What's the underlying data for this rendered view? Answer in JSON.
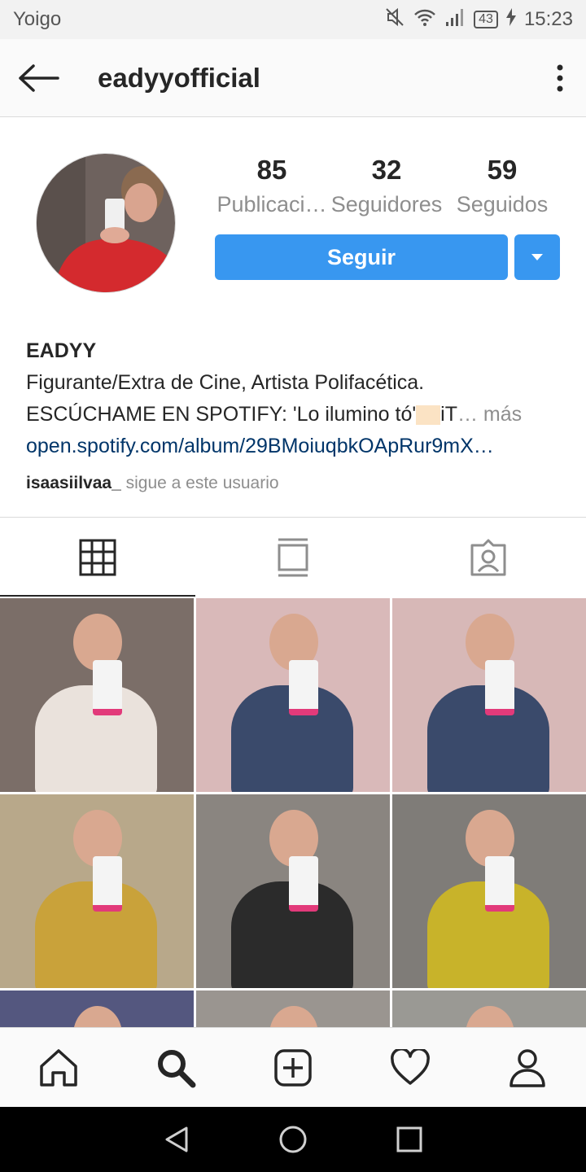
{
  "status_bar": {
    "carrier": "Yoigo",
    "battery": "43",
    "time": "15:23"
  },
  "header": {
    "username": "eadyyofficial"
  },
  "profile": {
    "stats": [
      {
        "number": "85",
        "label": "Publicaci…"
      },
      {
        "number": "32",
        "label": "Seguidores"
      },
      {
        "number": "59",
        "label": "Seguidos"
      }
    ],
    "follow_label": "Seguir",
    "name": "EADYY",
    "bio_line1": "Figurante/Extra de Cine, Artista Polifacética.",
    "bio_line2_start": "ESCÚCHAME EN SPOTIFY: 'Lo ilumino tó'",
    "bio_line2_end": "iT",
    "more_label": "… más",
    "link": "open.spotify.com/album/29BMoiuqbkOApRur9mX…",
    "followed_by_user": "isaasiilvaa_",
    "followed_by_text": " sigue a este usuario"
  },
  "tabs": [
    {
      "name": "grid",
      "icon": "grid-icon",
      "active": true
    },
    {
      "name": "feed",
      "icon": "feed-icon",
      "active": false
    },
    {
      "name": "tagged",
      "icon": "tagged-icon",
      "active": false
    }
  ],
  "posts": [
    {
      "bg": "#7b6e68",
      "accent": "#eae2dc"
    },
    {
      "bg": "#d9b9b9",
      "accent": "#3a4a6b"
    },
    {
      "bg": "#d7b8b7",
      "accent": "#3a4a6b"
    },
    {
      "bg": "#b8a88a",
      "accent": "#c9a23a"
    },
    {
      "bg": "#8a8580",
      "accent": "#2b2b2b"
    },
    {
      "bg": "#7f7c78",
      "accent": "#c8b32a"
    },
    {
      "bg": "#54577f",
      "accent": "#9a6c5a"
    },
    {
      "bg": "#9a9590",
      "accent": "#6d5a50"
    },
    {
      "bg": "#9a9994",
      "accent": "#7a6a62"
    }
  ],
  "bottom_nav": [
    "home-icon",
    "search-icon",
    "add-post-icon",
    "heart-icon",
    "profile-icon"
  ],
  "colors": {
    "accent": "#3897f0",
    "link": "#003569",
    "muted": "#8e8e8e"
  }
}
